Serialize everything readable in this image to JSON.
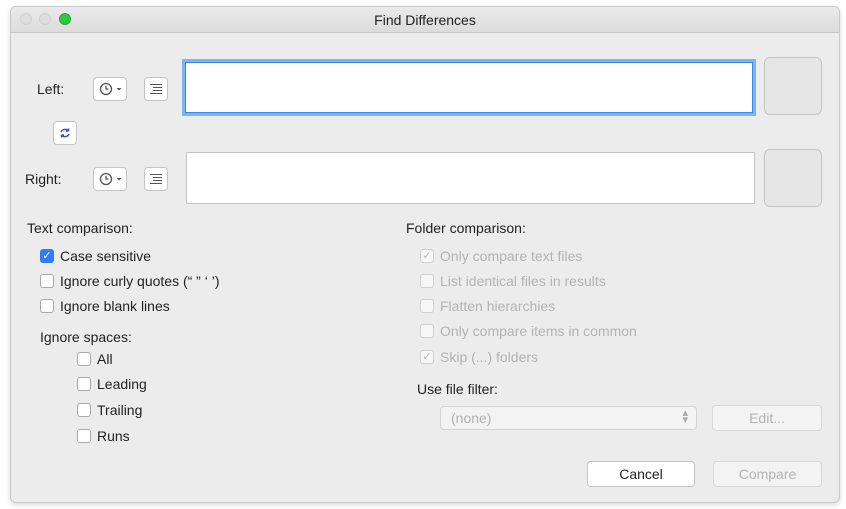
{
  "window": {
    "title": "Find Differences"
  },
  "left": {
    "label": "Left:",
    "value": ""
  },
  "right": {
    "label": "Right:",
    "value": ""
  },
  "icons": {
    "recent": "clock-icon",
    "list": "list-icon",
    "swap": "swap-icon"
  },
  "text_comparison": {
    "heading": "Text comparison:",
    "case_sensitive": {
      "label": "Case sensitive",
      "checked": true
    },
    "ignore_curly_quotes": {
      "label": "Ignore curly quotes (“ ” ‘ ’)",
      "checked": false
    },
    "ignore_blank_lines": {
      "label": "Ignore blank lines",
      "checked": false
    },
    "ignore_spaces": {
      "heading": "Ignore spaces:",
      "all": {
        "label": "All",
        "checked": false
      },
      "leading": {
        "label": "Leading",
        "checked": false
      },
      "trailing": {
        "label": "Trailing",
        "checked": false
      },
      "runs": {
        "label": "Runs",
        "checked": false
      }
    }
  },
  "folder_comparison": {
    "heading": "Folder comparison:",
    "only_text": {
      "label": "Only compare text files",
      "checked": true
    },
    "list_identical": {
      "label": "List identical files in results",
      "checked": false
    },
    "flatten": {
      "label": "Flatten hierarchies",
      "checked": false
    },
    "only_common": {
      "label": "Only compare items in common",
      "checked": false
    },
    "skip_folders": {
      "label": "Skip (...) folders",
      "checked": true
    },
    "file_filter": {
      "label": "Use file filter:",
      "value": "(none)",
      "edit_label": "Edit..."
    }
  },
  "buttons": {
    "cancel": "Cancel",
    "compare": "Compare"
  },
  "colors": {
    "accent": "#2f7cf6",
    "focus_ring": "#7db4f4",
    "zoom_button": "#2ec840"
  }
}
